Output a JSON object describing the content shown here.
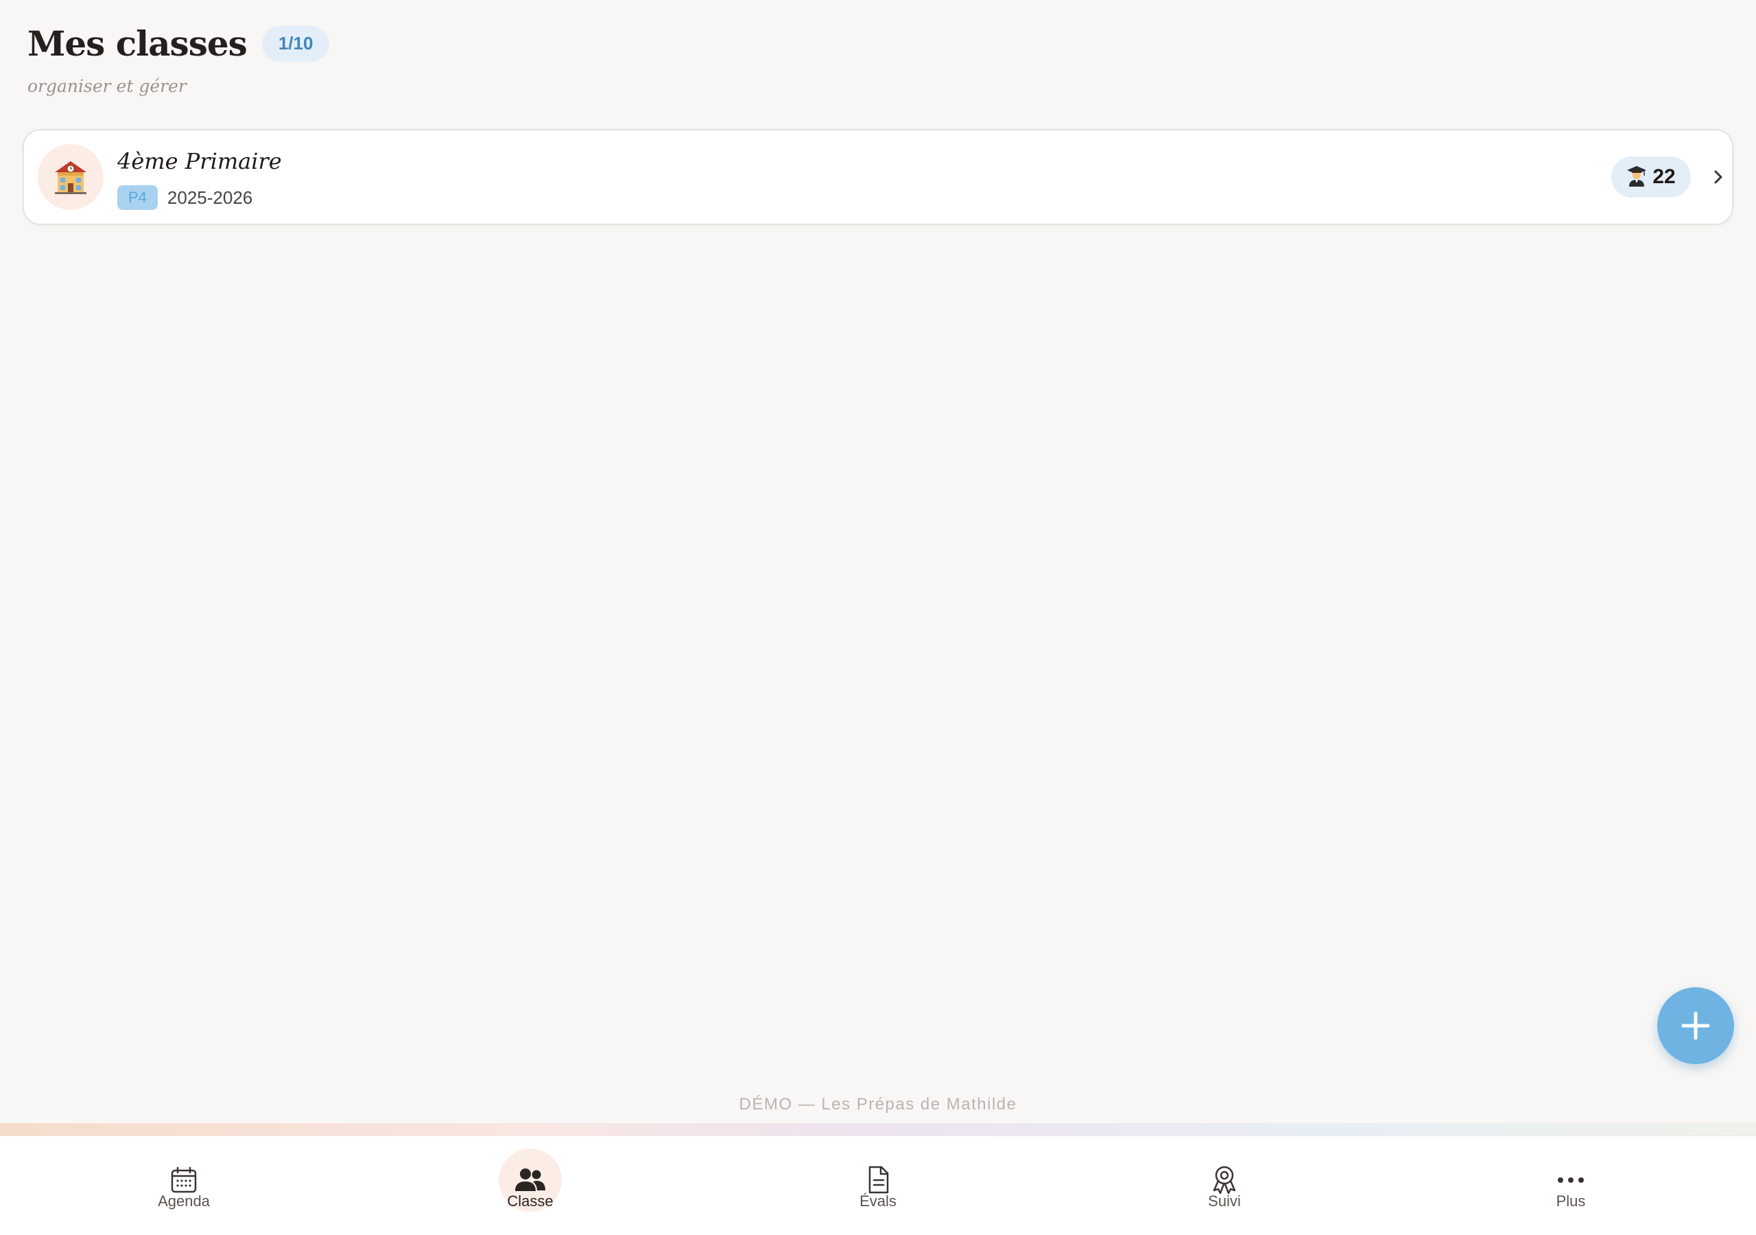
{
  "header": {
    "title": "Mes classes",
    "count_badge": "1/10",
    "subtitle": "organiser et gérer"
  },
  "classes": [
    {
      "icon": "school-building-icon",
      "name": "4ème Primaire",
      "level": "P4",
      "school_year": "2025-2026",
      "student_icon": "student-icon",
      "student_count": "22"
    }
  ],
  "fab": {
    "icon": "plus-icon",
    "accent": "#6fb3e3"
  },
  "footer": {
    "demo_text": "DÉMO — Les Prépas de Mathilde"
  },
  "nav": {
    "items": [
      {
        "label": "Agenda",
        "icon": "calendar-icon",
        "active": false
      },
      {
        "label": "Classe",
        "icon": "users-icon",
        "active": true
      },
      {
        "label": "Évals",
        "icon": "document-icon",
        "active": false
      },
      {
        "label": "Suivi",
        "icon": "award-icon",
        "active": false
      },
      {
        "label": "Plus",
        "icon": "more-icon",
        "active": false
      }
    ]
  },
  "colors": {
    "background": "#f8f7f5",
    "accent_blue": "#6fb3e3",
    "badge_blue_bg": "#e3eef8",
    "active_peach": "#fbede5"
  }
}
